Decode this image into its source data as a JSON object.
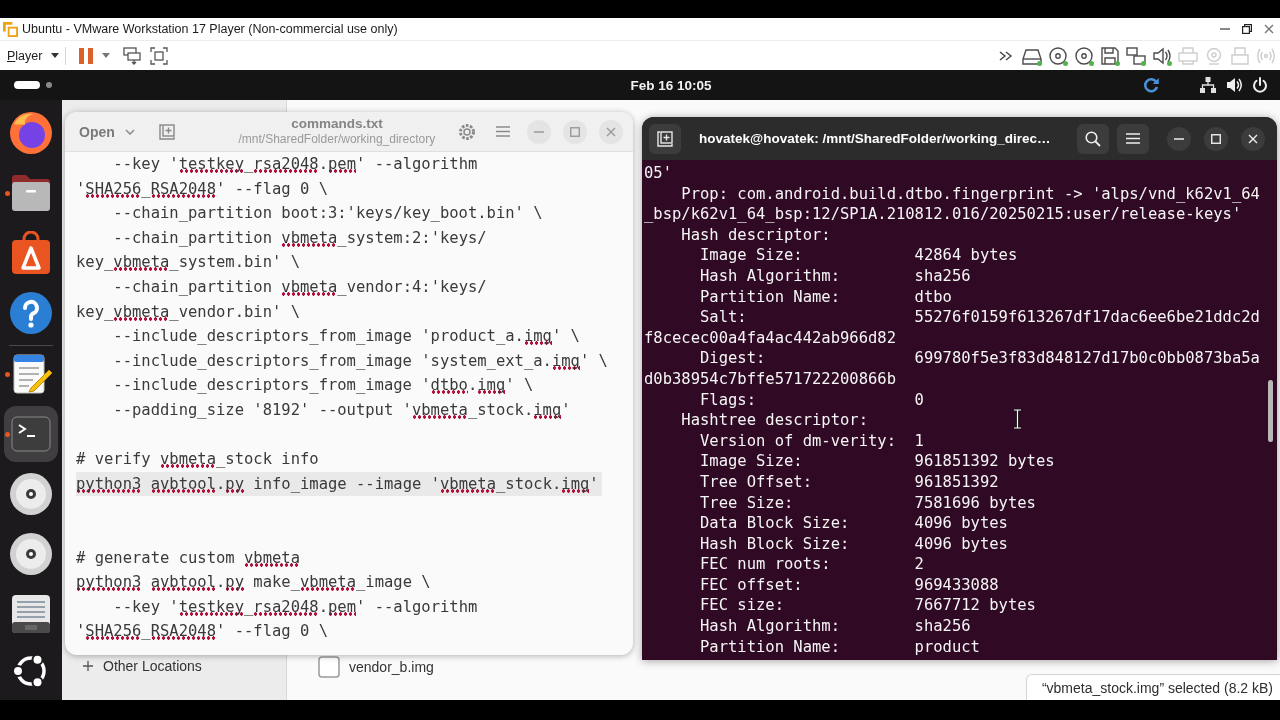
{
  "vmware": {
    "title": "Ubuntu - VMware Workstation 17 Player (Non-commercial use only)",
    "player_menu": "Player",
    "devices": [
      {
        "kind": "hard-disk",
        "connected": true
      },
      {
        "kind": "cd",
        "connected": true
      },
      {
        "kind": "cd",
        "connected": true
      },
      {
        "kind": "floppy",
        "connected": true
      },
      {
        "kind": "network",
        "connected": true
      },
      {
        "kind": "sound",
        "connected": true
      },
      {
        "kind": "printer",
        "connected": false
      },
      {
        "kind": "webcam",
        "connected": false
      },
      {
        "kind": "usb",
        "connected": false
      },
      {
        "kind": "wireless",
        "connected": false
      }
    ]
  },
  "topbar": {
    "workspaces": [
      {
        "selected": true
      },
      {
        "selected": false
      }
    ],
    "clock": "Feb 16 10:05"
  },
  "dock": {
    "pinned": [
      {
        "kind": "browser",
        "running": false,
        "selected": false
      },
      {
        "kind": "files",
        "running": true,
        "selected": false
      },
      {
        "kind": "app-center",
        "running": false,
        "selected": false
      },
      {
        "kind": "help",
        "running": false,
        "selected": false
      }
    ],
    "other": [
      {
        "kind": "text-editor",
        "running": true,
        "selected": false
      },
      {
        "kind": "terminal",
        "running": true,
        "selected": true
      },
      {
        "kind": "disc",
        "running": false,
        "selected": false
      },
      {
        "kind": "disc",
        "running": false,
        "selected": false
      },
      {
        "kind": "drive",
        "running": false,
        "selected": false
      }
    ]
  },
  "files": {
    "sidebar_item": "Other Locations",
    "file": "vendor_b.img",
    "status": "“vbmeta_stock.img” selected (8.2 kB)"
  },
  "editor": {
    "open_button": "Open",
    "title": "commands.txt",
    "subtitle": "/mnt/SharedFolder/working_directory",
    "lines": [
      {
        "kind": "code",
        "current": false,
        "segments": [
          {
            "text": "    --key '",
            "misspelled": false
          },
          {
            "text": "testkey",
            "misspelled": true
          },
          {
            "text": "_",
            "misspelled": false
          },
          {
            "text": "rsa2048",
            "misspelled": true
          },
          {
            "text": ".",
            "misspelled": false
          },
          {
            "text": "pem",
            "misspelled": true
          },
          {
            "text": "' --algorithm",
            "misspelled": false
          }
        ]
      },
      {
        "kind": "code",
        "current": false,
        "segments": [
          {
            "text": "'",
            "misspelled": false
          },
          {
            "text": "SHA256",
            "misspelled": true
          },
          {
            "text": "_",
            "misspelled": false
          },
          {
            "text": "RSA2048",
            "misspelled": true
          },
          {
            "text": "' --flag 0 \\",
            "misspelled": false
          }
        ]
      },
      {
        "kind": "code",
        "current": false,
        "segments": [
          {
            "text": "    --chain_partition boot:3:'keys/key_boot.bin' \\",
            "misspelled": false
          }
        ]
      },
      {
        "kind": "code",
        "current": false,
        "segments": [
          {
            "text": "    --chain_partition ",
            "misspelled": false
          },
          {
            "text": "vbmeta",
            "misspelled": true
          },
          {
            "text": "_system:2:'keys/",
            "misspelled": false
          }
        ]
      },
      {
        "kind": "code",
        "current": false,
        "segments": [
          {
            "text": "key_",
            "misspelled": false
          },
          {
            "text": "vbmeta",
            "misspelled": true
          },
          {
            "text": "_system.bin' \\",
            "misspelled": false
          }
        ]
      },
      {
        "kind": "code",
        "current": false,
        "segments": [
          {
            "text": "    --chain_partition ",
            "misspelled": false
          },
          {
            "text": "vbmeta",
            "misspelled": true
          },
          {
            "text": "_vendor:4:'keys/",
            "misspelled": false
          }
        ]
      },
      {
        "kind": "code",
        "current": false,
        "segments": [
          {
            "text": "key_",
            "misspelled": false
          },
          {
            "text": "vbmeta",
            "misspelled": true
          },
          {
            "text": "_vendor.bin' \\",
            "misspelled": false
          }
        ]
      },
      {
        "kind": "code",
        "current": false,
        "segments": [
          {
            "text": "    --include_descriptors_from_image 'product_a.",
            "misspelled": false
          },
          {
            "text": "img",
            "misspelled": true
          },
          {
            "text": "' \\",
            "misspelled": false
          }
        ]
      },
      {
        "kind": "code",
        "current": false,
        "segments": [
          {
            "text": "    --include_descriptors_from_image 'system_ext_a.",
            "misspelled": false
          },
          {
            "text": "img",
            "misspelled": true
          },
          {
            "text": "' \\",
            "misspelled": false
          }
        ]
      },
      {
        "kind": "code",
        "current": false,
        "segments": [
          {
            "text": "    --include_descriptors_from_image '",
            "misspelled": false
          },
          {
            "text": "dtbo",
            "misspelled": true
          },
          {
            "text": ".",
            "misspelled": false
          },
          {
            "text": "img",
            "misspelled": true
          },
          {
            "text": "' \\",
            "misspelled": false
          }
        ]
      },
      {
        "kind": "code",
        "current": false,
        "segments": [
          {
            "text": "    --padding_size '8192' --output '",
            "misspelled": false
          },
          {
            "text": "vbmeta",
            "misspelled": true
          },
          {
            "text": "_stock.",
            "misspelled": false
          },
          {
            "text": "img",
            "misspelled": true
          },
          {
            "text": "'",
            "misspelled": false
          }
        ]
      },
      {
        "kind": "blank"
      },
      {
        "kind": "code",
        "current": false,
        "segments": [
          {
            "text": "# verify ",
            "misspelled": false
          },
          {
            "text": "vbmeta",
            "misspelled": true
          },
          {
            "text": "_stock info",
            "misspelled": false
          }
        ]
      },
      {
        "kind": "code",
        "current": true,
        "segments": [
          {
            "text": "python3 ",
            "misspelled": true
          },
          {
            "text": "avbtool",
            "misspelled": true
          },
          {
            "text": ".",
            "misspelled": false
          },
          {
            "text": "py",
            "misspelled": true
          },
          {
            "text": " info_image --image '",
            "misspelled": false
          },
          {
            "text": "vbmeta",
            "misspelled": true
          },
          {
            "text": "_stock.",
            "misspelled": false
          },
          {
            "text": "img",
            "misspelled": true
          },
          {
            "text": "'",
            "misspelled": false
          }
        ]
      },
      {
        "kind": "blank"
      },
      {
        "kind": "blank"
      },
      {
        "kind": "code",
        "current": false,
        "segments": [
          {
            "text": "# generate custom ",
            "misspelled": false
          },
          {
            "text": "vbmeta",
            "misspelled": true
          }
        ]
      },
      {
        "kind": "code",
        "current": false,
        "segments": [
          {
            "text": "python3 ",
            "misspelled": true
          },
          {
            "text": "avbtool",
            "misspelled": true
          },
          {
            "text": ".",
            "misspelled": false
          },
          {
            "text": "py",
            "misspelled": true
          },
          {
            "text": " make_",
            "misspelled": false
          },
          {
            "text": "vbmeta",
            "misspelled": true
          },
          {
            "text": "_image \\",
            "misspelled": false
          }
        ]
      },
      {
        "kind": "code",
        "current": false,
        "segments": [
          {
            "text": "    --key '",
            "misspelled": false
          },
          {
            "text": "testkey",
            "misspelled": true
          },
          {
            "text": "_",
            "misspelled": false
          },
          {
            "text": "rsa2048",
            "misspelled": true
          },
          {
            "text": ".",
            "misspelled": false
          },
          {
            "text": "pem",
            "misspelled": true
          },
          {
            "text": "' --algorithm",
            "misspelled": false
          }
        ]
      },
      {
        "kind": "code",
        "current": false,
        "segments": [
          {
            "text": "'",
            "misspelled": false
          },
          {
            "text": "SHA256",
            "misspelled": true
          },
          {
            "text": "_",
            "misspelled": false
          },
          {
            "text": "RSA2048",
            "misspelled": true
          },
          {
            "text": "' --flag 0 \\",
            "misspelled": false
          }
        ]
      }
    ]
  },
  "terminal": {
    "title": "hovatek@hovatek: /mnt/SharedFolder/working_direc…",
    "lines": [
      "05'",
      "    Prop: com.android.build.dtbo.fingerprint -> 'alps/vnd_k62v1_64",
      "_bsp/k62v1_64_bsp:12/SP1A.210812.016/20250215:user/release-keys'",
      "    Hash descriptor:",
      "      Image Size:            42864 bytes",
      "      Hash Algorithm:        sha256",
      "      Partition Name:        dtbo",
      "      Salt:                  55276f0159f613267df17dac6ee6be21ddc2d",
      "f8cecec00a4fa4ac442ab966d82",
      "      Digest:                699780f5e3f83d848127d17b0c0bb0873ba5a",
      "d0b38954c7bffe571722200866b",
      "      Flags:                 0",
      "    Hashtree descriptor:",
      "      Version of dm-verity:  1",
      "      Image Size:            961851392 bytes",
      "      Tree Offset:           961851392",
      "      Tree Size:             7581696 bytes",
      "      Data Block Size:       4096 bytes",
      "      Hash Block Size:       4096 bytes",
      "      FEC num roots:         2",
      "      FEC offset:            969433088",
      "      FEC size:              7667712 bytes",
      "      Hash Algorithm:        sha256",
      "      Partition Name:        product"
    ]
  }
}
